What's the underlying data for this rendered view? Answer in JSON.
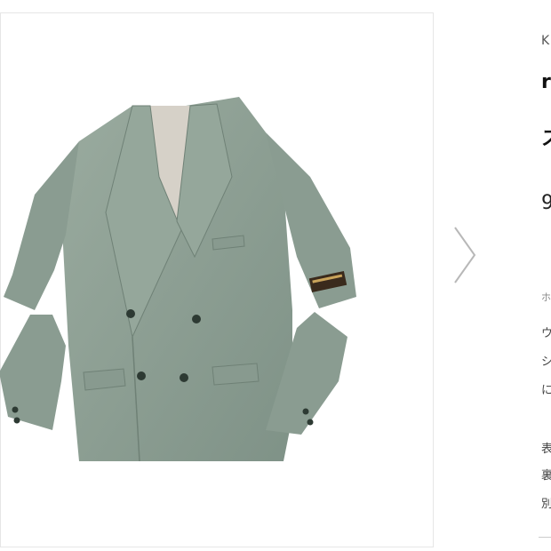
{
  "product": {
    "image_alt": "Gray-green double-breasted jacket with sleeve cut-outs and brand patch",
    "brand_fragment": "K",
    "title_line1_fragment": "r",
    "title_line2_fragment": "ス",
    "price_fragment": "9",
    "category_fragment": "ホ",
    "description_lines": [
      "ウ",
      "シ",
      "に"
    ],
    "spec_lines": [
      "表",
      "裏",
      "別"
    ]
  },
  "colors": {
    "jacket": "#8d9f95",
    "frame_border": "#e6e6e6",
    "arrow": "#b8b8b8"
  },
  "icons": {
    "next": "chevron-right-icon"
  }
}
